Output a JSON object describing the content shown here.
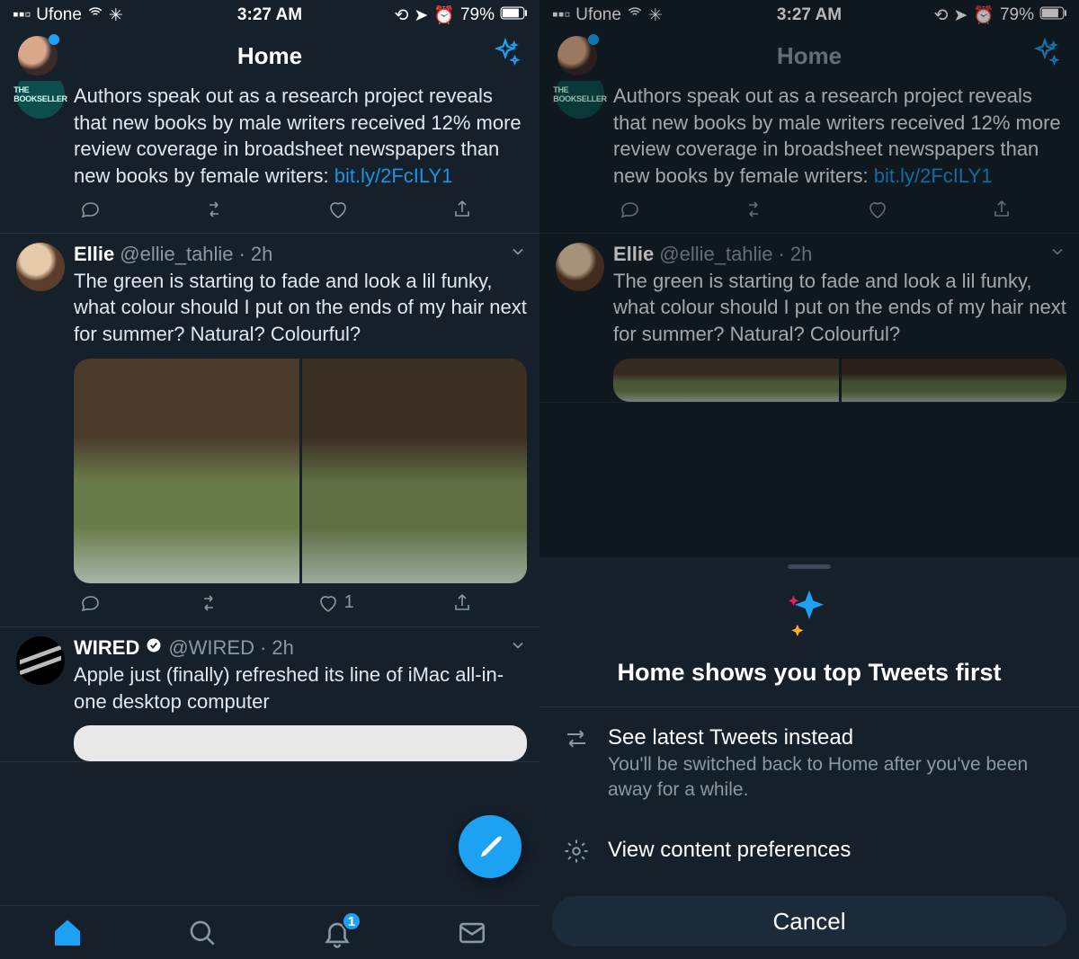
{
  "status": {
    "carrier": "Ufone",
    "time": "3:27 AM",
    "battery": "79%"
  },
  "header": {
    "title": "Home"
  },
  "tweets": {
    "t0": {
      "avatar_label": "THE BOOKSELLER",
      "text": "Authors speak out as a research project reveals that new books by male writers received 12% more review coverage in broadsheet newspapers than new books by female writers: ",
      "link": "bit.ly/2FcILY1"
    },
    "t1": {
      "name": "Ellie",
      "handle": "@ellie_tahlie",
      "time": "2h",
      "text": "The green is starting to fade and look a lil funky, what colour should I put on the ends of my hair next for summer? Natural? Colourful?",
      "like_count": "1"
    },
    "t2": {
      "name": "WIRED",
      "handle": "@WIRED",
      "time": "2h",
      "text": "Apple just (finally) refreshed its line of iMac all-in-one desktop computer"
    }
  },
  "nav": {
    "badge": "1"
  },
  "sheet": {
    "title": "Home shows you top Tweets first",
    "row1_title": "See latest Tweets instead",
    "row1_sub": "You'll be switched back to Home after you've been away for a while.",
    "row2_title": "View content preferences",
    "cancel": "Cancel"
  }
}
